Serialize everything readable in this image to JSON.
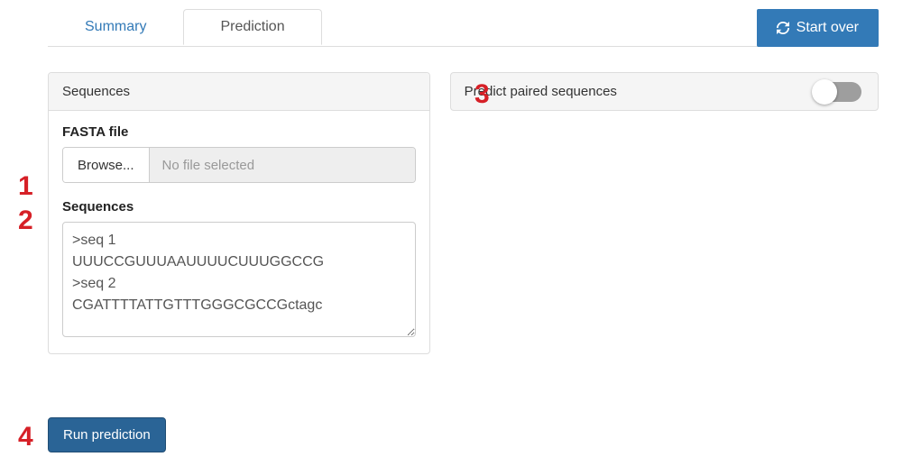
{
  "tabs": {
    "summary": "Summary",
    "prediction": "Prediction"
  },
  "start_over": "Start over",
  "left_panel": {
    "heading": "Sequences",
    "fasta_label": "FASTA file",
    "browse_label": "Browse...",
    "file_status": "No file selected",
    "sequences_label": "Sequences",
    "sequences_value": ">seq 1\nUUUCCGUUUAAUUUUCUUUGGCCG\n>seq 2\nCGATTTTATTGTTTGGGCGCCGctagc"
  },
  "right_panel": {
    "label": "Predict paired sequences",
    "enabled": false
  },
  "run_button": "Run prediction",
  "annotations": {
    "a1": "1",
    "a2": "2",
    "a3": "3",
    "a4": "4"
  }
}
